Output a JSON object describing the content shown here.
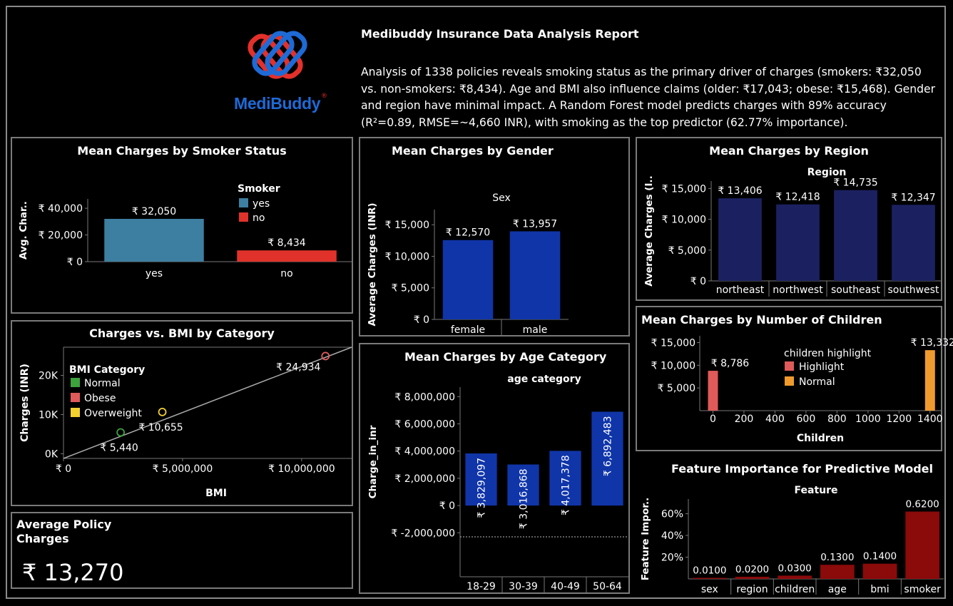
{
  "logo": {
    "text": "MediBuddy",
    "trademark": "®"
  },
  "report": {
    "title": "Medibuddy Insurance Data Analysis Report",
    "summary": "Analysis of 1338 policies reveals smoking status as the primary driver of charges (smokers: ₹32,050 vs. non-smokers: ₹8,434). Age and BMI also influence claims (older: ₹17,043; obese: ₹15,468). Gender and region have minimal impact. A Random Forest model predicts charges with 89% accuracy (R²=0.89, RMSE=~4,660 INR), with smoking as the top predictor (62.77% importance)."
  },
  "kpi": {
    "title": "Average Policy Charges",
    "value": "₹ 13,270"
  },
  "colors": {
    "yes": "#3d7fa0",
    "no": "#e0322a",
    "blue": "#1035a8",
    "navy": "#1b2160",
    "darkred": "#8b0a0a",
    "highlight": "#e05a5a",
    "normal": "#f09a2e",
    "green": "#3da33d",
    "obese": "#e05a5a",
    "overweight": "#f2d030"
  },
  "chart_data": [
    {
      "id": "smoker",
      "type": "bar",
      "title": "Mean Charges by Smoker Status",
      "ylabel": "Avg. Char..",
      "legend_title": "Smoker",
      "legend": [
        "yes",
        "no"
      ],
      "categories": [
        "yes",
        "no"
      ],
      "values": [
        32050,
        8434
      ],
      "labels": [
        "₹ 32,050",
        "₹ 8,434"
      ],
      "yticks": [
        0,
        20000,
        40000
      ],
      "ytick_labels": [
        "₹ 0",
        "₹ 20,000",
        "₹ 40,000"
      ],
      "ylim": [
        0,
        47000
      ]
    },
    {
      "id": "gender",
      "type": "bar",
      "title": "Mean Charges by Gender",
      "ylabel": "Average Charges (INR)",
      "header": "Sex",
      "categories": [
        "female",
        "male"
      ],
      "values": [
        12570,
        13957
      ],
      "labels": [
        "₹ 12,570",
        "₹ 13,957"
      ],
      "yticks": [
        0,
        5000,
        10000,
        15000
      ],
      "ytick_labels": [
        "₹ 0",
        "₹ 5,000",
        "₹ 10,000",
        "₹ 15,000"
      ],
      "ylim": [
        0,
        17400
      ]
    },
    {
      "id": "region",
      "type": "bar",
      "title": "Mean Charges by Region",
      "ylabel": "Average Charges (I..",
      "header": "Region",
      "categories": [
        "northeast",
        "northwest",
        "southeast",
        "southwest"
      ],
      "values": [
        13406,
        12418,
        14735,
        12347
      ],
      "labels": [
        "₹ 13,406",
        "₹ 12,418",
        "₹ 14,735",
        "₹ 12,347"
      ],
      "yticks": [
        0,
        5000,
        10000,
        15000
      ],
      "ytick_labels": [
        "₹ 0",
        "₹ 5,000",
        "₹ 10,000",
        "₹ 15,000"
      ],
      "ylim": [
        0,
        16200
      ]
    },
    {
      "id": "bmi",
      "type": "scatter",
      "title": "Charges vs. BMI by Category",
      "xlabel": "BMI",
      "ylabel": "Charges (INR)",
      "legend_title": "BMI Category",
      "legend": [
        "Normal",
        "Obese",
        "Overweight"
      ],
      "points": [
        {
          "category": "Normal",
          "x": 2400000,
          "y": 5440,
          "label": "₹ 5,440"
        },
        {
          "category": "Overweight",
          "x": 4150000,
          "y": 10655,
          "label": "₹ 10,655"
        },
        {
          "category": "Obese",
          "x": 11000000,
          "y": 24934,
          "label": "₹ 24,934"
        }
      ],
      "xticks": [
        0,
        5000000,
        10000000
      ],
      "xtick_labels": [
        "₹ 0",
        "₹ 5,000,000",
        "₹ 10,000,000"
      ],
      "xlim": [
        0,
        12100000
      ],
      "yticks": [
        0,
        10000,
        20000
      ],
      "ytick_labels": [
        "0K",
        "10K",
        "20K"
      ],
      "ylim": [
        -1200,
        27200
      ],
      "trendline": [
        [
          0,
          -1200
        ],
        [
          12100000,
          27200
        ]
      ]
    },
    {
      "id": "age",
      "type": "bar",
      "title": "Mean Charges by Age Category",
      "ylabel": "Charge_in_inr",
      "header": "age category",
      "categories": [
        "18-29",
        "30-39",
        "40-49",
        "50-64"
      ],
      "values": [
        3829097,
        3016868,
        4017378,
        6892483
      ],
      "labels": [
        "₹ 3,829,097",
        "₹ 3,016,868",
        "₹ 4,017,378",
        "₹ 6,892,483"
      ],
      "yticks": [
        -2000000,
        0,
        2000000,
        4000000,
        6000000,
        8000000
      ],
      "ytick_labels": [
        "₹ -2,000,000",
        "₹ 0",
        "₹ 2,000,000",
        "₹ 4,000,000",
        "₹ 6,000,000",
        "₹ 8,000,000"
      ],
      "ylim": [
        -2300000,
        8700000
      ]
    },
    {
      "id": "children",
      "type": "bar",
      "title": "Mean Charges by Number of Children",
      "xlabel": "Children",
      "legend_title": "children highlight",
      "legend": [
        "Highlight",
        "Normal"
      ],
      "points": [
        {
          "x": 0,
          "y": 8786,
          "label": "₹ 8,786",
          "group": "Highlight"
        },
        {
          "x": 1400,
          "y": 13332,
          "label": "₹ 13,332",
          "group": "Normal"
        }
      ],
      "xticks": [
        0,
        200,
        400,
        600,
        800,
        1000,
        1200,
        1400
      ],
      "xlim": [
        -85,
        1470
      ],
      "yticks": [
        5000,
        10000,
        15000
      ],
      "ytick_labels": [
        "₹ 5,000",
        "₹ 10,000",
        "₹ 15,000"
      ],
      "ylim": [
        0,
        16500
      ]
    },
    {
      "id": "features",
      "type": "bar",
      "title": "Feature Importance for Predictive Model",
      "ylabel": "Feature Impor..",
      "header": "Feature",
      "categories": [
        "sex",
        "region",
        "children",
        "age",
        "bmi",
        "smoker"
      ],
      "values": [
        0.01,
        0.02,
        0.03,
        0.13,
        0.14,
        0.62
      ],
      "labels": [
        "0.0100",
        "0.0200",
        "0.0300",
        "0.1300",
        "0.1400",
        "0.6200"
      ],
      "yticks": [
        0.2,
        0.4,
        0.6
      ],
      "ytick_labels": [
        "20%",
        "40%",
        "60%"
      ],
      "ylim": [
        0,
        0.735
      ]
    }
  ]
}
